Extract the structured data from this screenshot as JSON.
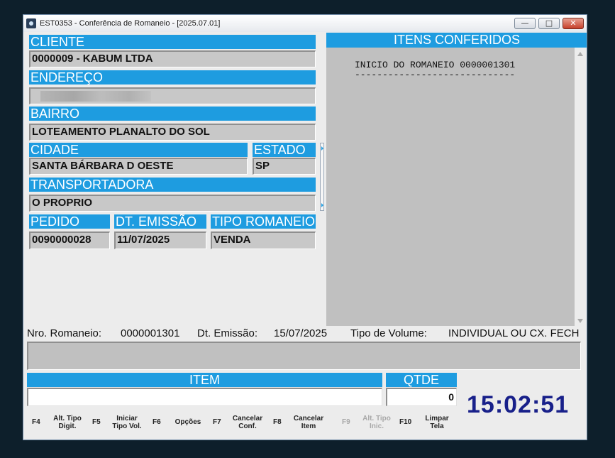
{
  "window": {
    "title": "EST0353 - Conferência de Romaneio - [2025.07.01]",
    "minimize_glyph": "—",
    "maximize_glyph": "□",
    "close_glyph": "✕"
  },
  "cliente": {
    "label": "CLIENTE",
    "value": "0000009 - KABUM LTDA"
  },
  "endereco": {
    "label": "ENDEREÇO",
    "value": ""
  },
  "bairro": {
    "label": "BAIRRO",
    "value": "LOTEAMENTO PLANALTO DO SOL"
  },
  "cidade": {
    "label": "CIDADE",
    "value": "SANTA BÁRBARA D OESTE"
  },
  "estado": {
    "label": "ESTADO",
    "value": "SP"
  },
  "transportadora": {
    "label": "TRANSPORTADORA",
    "value": "O PROPRIO"
  },
  "pedido": {
    "label": "PEDIDO",
    "value": "0090000028"
  },
  "dt_emissao": {
    "label": "DT. EMISSÃO",
    "value": "11/07/2025"
  },
  "tipo_romaneio": {
    "label": "TIPO ROMANEIO",
    "value": "VENDA"
  },
  "itens": {
    "header": "ITENS CONFERIDOS",
    "lines": [
      "INICIO DO ROMANEIO 0000001301",
      "-----------------------------"
    ]
  },
  "info": {
    "nro_label": "Nro. Romaneio:",
    "nro_value": "0000001301",
    "dt_label": "Dt. Emissão:",
    "dt_value": "15/07/2025",
    "tipo_label": "Tipo de Volume:",
    "tipo_value": "INDIVIDUAL OU CX. FECH"
  },
  "item": {
    "label": "ITEM",
    "value": ""
  },
  "qtde": {
    "label": "QTDE",
    "value": "0"
  },
  "clock": "15:02:51",
  "function_keys": [
    {
      "key": "F4",
      "label_1": "Alt. Tipo",
      "label_2": "Digit.",
      "enabled": true
    },
    {
      "key": "F5",
      "label_1": "Iniciar",
      "label_2": "Tipo Vol.",
      "enabled": true
    },
    {
      "key": "F6",
      "label_1": "Opções",
      "label_2": "",
      "enabled": true
    },
    {
      "key": "F7",
      "label_1": "Cancelar",
      "label_2": "Conf.",
      "enabled": true
    },
    {
      "key": "F8",
      "label_1": "Cancelar",
      "label_2": "Item",
      "enabled": true
    },
    {
      "key": "F9",
      "label_1": "Alt. Tipo",
      "label_2": "Inic.",
      "enabled": false
    },
    {
      "key": "F10",
      "label_1": "Limpar",
      "label_2": "Tela",
      "enabled": true
    }
  ]
}
